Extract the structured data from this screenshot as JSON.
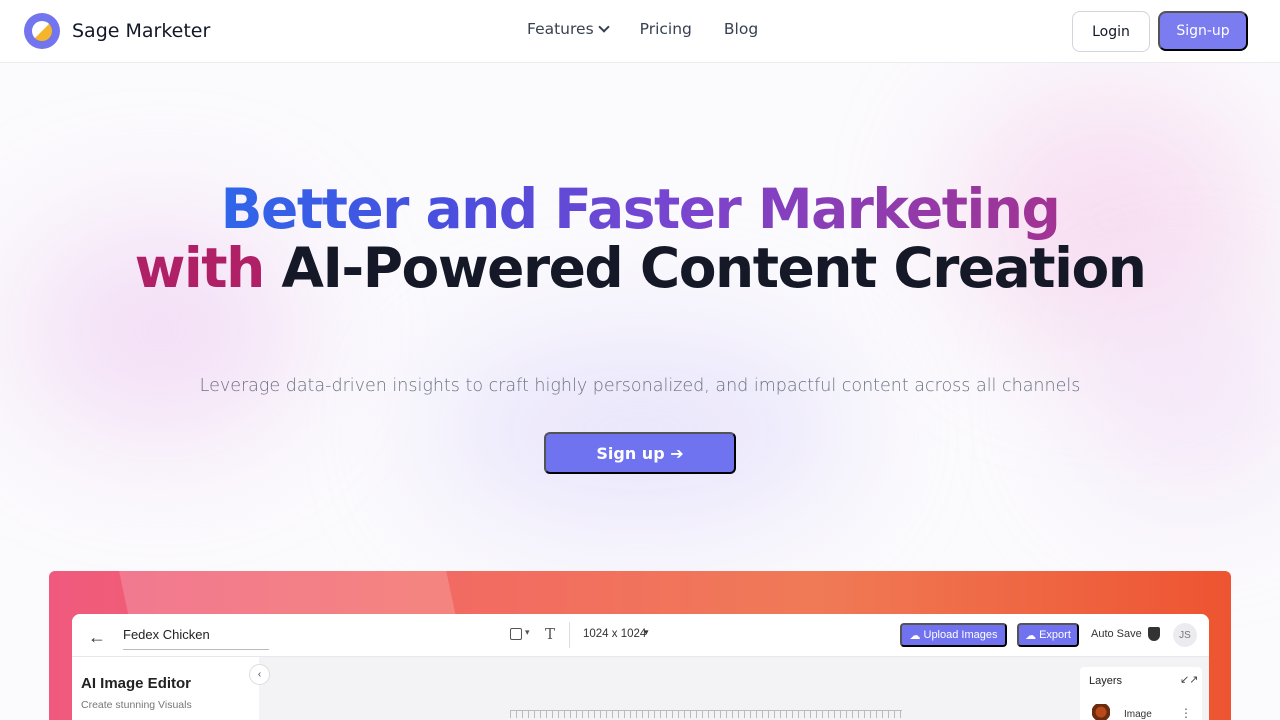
{
  "brand": {
    "name": "Sage Marketer",
    "logo_icon": "logo-icon"
  },
  "nav": {
    "features": "Features",
    "pricing": "Pricing",
    "blog": "Blog"
  },
  "header": {
    "login": "Login",
    "signup": "Sign-up"
  },
  "hero": {
    "title_part1": "Better and Faster Marketing",
    "title_part2": "with",
    "title_part3": "AI-Powered Content Creation",
    "subtitle": "Leverage data-driven insights to craft highly personalized, and impactful content across all channels",
    "cta": "Sign up ➔"
  },
  "colors": {
    "accent": "#7a7cf0",
    "gradient_blue": "#2f66ea",
    "gradient_magenta": "#b02066",
    "dark_text": "#141827"
  },
  "app_preview": {
    "doc_name": "Fedex Chicken",
    "canvas_size": "1024 x 1024",
    "upload_button": "Upload Images",
    "export_button": "Export",
    "auto_save": "Auto Save",
    "user_initials": "JS",
    "panel_title": "AI Image Editor",
    "panel_subtitle": "Create stunning Visuals",
    "layers_title": "Layers",
    "layer_item": "Image"
  }
}
